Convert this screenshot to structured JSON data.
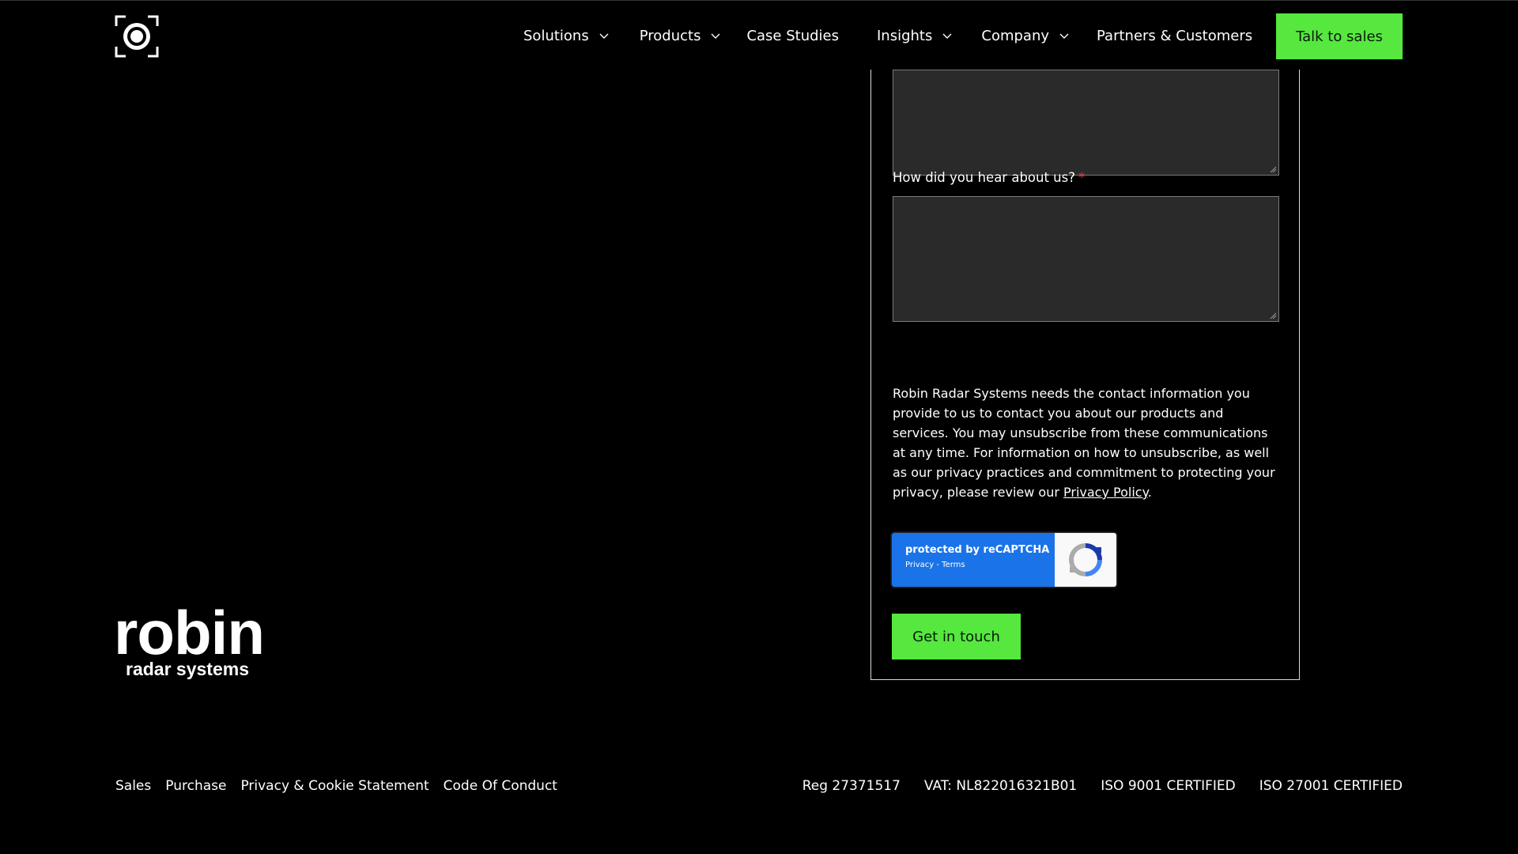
{
  "header": {
    "nav": [
      {
        "label": "Solutions",
        "has_dropdown": true
      },
      {
        "label": "Products",
        "has_dropdown": true
      },
      {
        "label": "Case Studies",
        "has_dropdown": false
      },
      {
        "label": "Insights",
        "has_dropdown": true
      },
      {
        "label": "Company",
        "has_dropdown": true
      },
      {
        "label": "Partners & Customers",
        "has_dropdown": false
      }
    ],
    "cta_label": "Talk to sales"
  },
  "form": {
    "hear_about_label": "How did you hear about us?",
    "required_marker": "*",
    "notice_text": "Robin Radar Systems needs the contact information you provide to us to contact you about our products and services. You may unsubscribe from these communications at any time. For information on how to unsubscribe, as well as our privacy practices and commitment to protecting your privacy, please review our ",
    "privacy_link": "Privacy Policy",
    "notice_end": ".",
    "recaptcha": {
      "title": "protected by reCAPTCHA",
      "links": "Privacy - Terms"
    },
    "submit_label": "Get in touch"
  },
  "brand": {
    "name": "robin",
    "tagline": "radar systems"
  },
  "footer": {
    "links": [
      "Sales",
      "Purchase",
      "Privacy & Cookie Statement",
      "Code Of Conduct"
    ],
    "info": [
      "Reg 27371517",
      "VAT: NL822016321B01",
      "ISO 9001 CERTIFIED",
      "ISO 27001 CERTIFIED"
    ]
  },
  "colors": {
    "accent": "#56e83f",
    "background": "#000000",
    "field_bg": "#2a2a2a",
    "required": "#e23a3a",
    "recaptcha_blue": "#1a73e8"
  },
  "icons": {
    "logo": "camera-focus-icon",
    "chevron": "chevron-down-icon",
    "recaptcha": "recaptcha-logo-icon"
  }
}
